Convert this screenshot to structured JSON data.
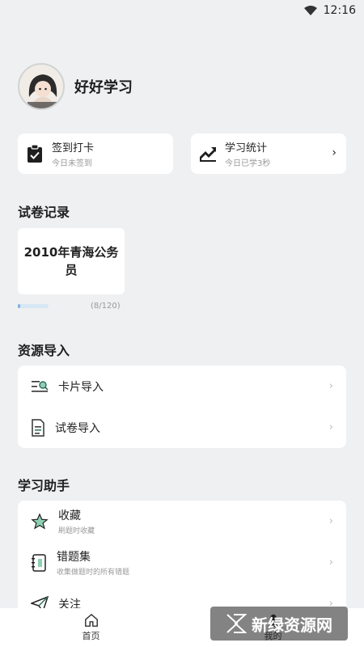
{
  "status": {
    "time": "12:16"
  },
  "profile": {
    "name": "好好学习",
    "avatar_icon": "avatar-girl"
  },
  "quick_cards": [
    {
      "title": "签到打卡",
      "subtitle": "今日未签到",
      "icon": "clipboard-check-icon"
    },
    {
      "title": "学习统计",
      "subtitle": "今日已学3秒",
      "icon": "trend-chart-icon"
    }
  ],
  "exam_records": {
    "title": "试卷记录",
    "paper": {
      "name": "2010年青海公务员",
      "progress": "(8/120)",
      "progress_value": 0.067
    }
  },
  "resource_import": {
    "title": "资源导入",
    "items": [
      {
        "label": "卡片导入",
        "icon": "card-search-icon"
      },
      {
        "label": "试卷导入",
        "icon": "document-icon"
      }
    ]
  },
  "study_helper": {
    "title": "学习助手",
    "items": [
      {
        "label": "收藏",
        "desc": "刷题时收藏",
        "icon": "star-icon"
      },
      {
        "label": "错题集",
        "desc": "收集做题时的所有错题",
        "icon": "notebook-icon"
      },
      {
        "label": "关注",
        "desc": "",
        "icon": "send-icon"
      }
    ]
  },
  "tab_bar": {
    "home": "首页",
    "mine": "我的"
  },
  "watermark": {
    "text": "新绿资源网"
  },
  "colors": {
    "accent": "#7fb3e3",
    "background": "#eef0f2",
    "icon_green": "#2e6b5d"
  }
}
